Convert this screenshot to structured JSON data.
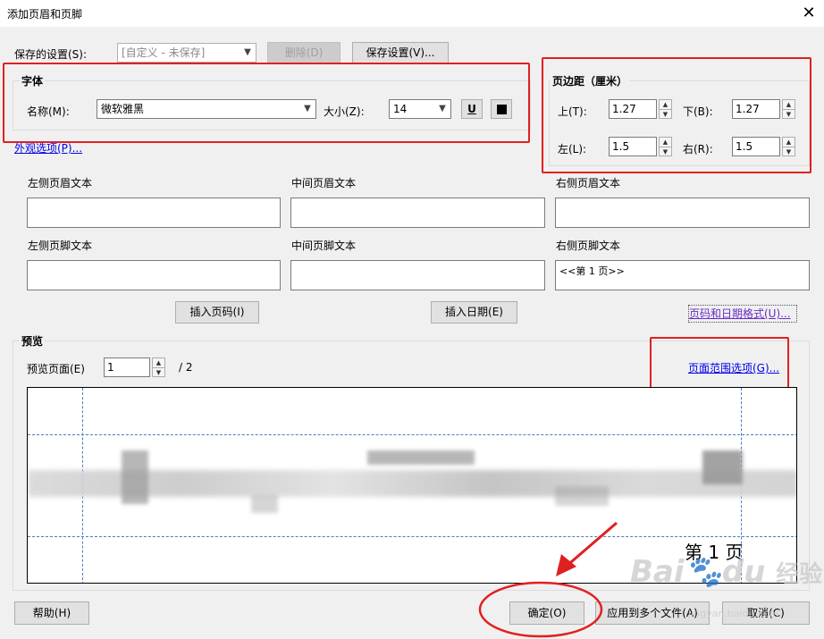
{
  "window": {
    "title": "添加页眉和页脚",
    "close_glyph": "✕"
  },
  "settings": {
    "label": "保存的设置(S):",
    "value": "[自定义 - 未保存]",
    "delete_btn": "删除(D)",
    "save_btn": "保存设置(V)..."
  },
  "font": {
    "group_title": "字体",
    "name_label": "名称(M):",
    "name_value": "微软雅黑",
    "size_label": "大小(Z):",
    "size_value": "14",
    "underline_glyph": "U"
  },
  "appearance_link": "外观选项(P)...",
  "margins": {
    "group_title": "页边距（厘米）",
    "top_label": "上(T):",
    "top_value": "1.27",
    "bottom_label": "下(B):",
    "bottom_value": "1.27",
    "left_label": "左(L):",
    "left_value": "1.5",
    "right_label": "右(R):",
    "right_value": "1.5"
  },
  "header": {
    "left_label": "左侧页眉文本",
    "center_label": "中间页眉文本",
    "right_label": "右侧页眉文本"
  },
  "footer": {
    "left_label": "左侧页脚文本",
    "center_label": "中间页脚文本",
    "right_label": "右侧页脚文本",
    "right_value": "<<第 1 页>>"
  },
  "insert_page_btn": "插入页码(I)",
  "insert_date_btn": "插入日期(E)",
  "format_link": "页码和日期格式(U)...",
  "preview": {
    "group_title": "预览",
    "page_label": "预览页面(E)",
    "page_value": "1",
    "page_total": "/ 2",
    "range_link": "页面范围选项(G)...",
    "footer_text": "第 1 页"
  },
  "buttons": {
    "help": "帮助(H)",
    "ok": "确定(O)",
    "apply_multi": "应用到多个文件(A)",
    "cancel": "取消(C)"
  },
  "watermark": {
    "logo_text": "Bai",
    "logo_text2": "du",
    "logo_cn": "经验",
    "url": "jingyan.baidu.com"
  },
  "colors": {
    "annotation_red": "#e02020",
    "link_blue": "#0000ee",
    "guide_blue": "#4a7ac8"
  }
}
